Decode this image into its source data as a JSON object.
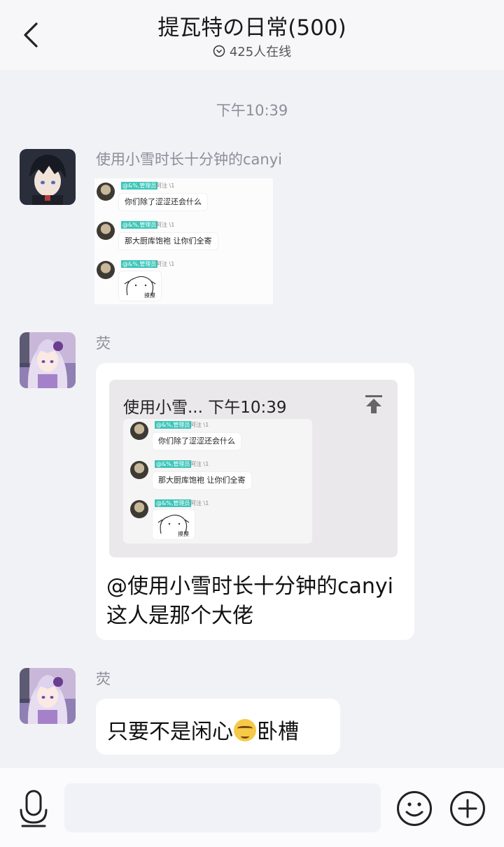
{
  "header": {
    "title": "提瓦特の日常(500)",
    "online_text": "425人在线"
  },
  "timestamp": "下午10:39",
  "messages": [
    {
      "sender": "使用小雪时长十分钟的canyi",
      "screenshot": {
        "rows": [
          {
            "tag": "@&%,管理员",
            "name": "阿注 \\1",
            "text": "你们除了涩涩还会什么"
          },
          {
            "tag": "@&%,管理员",
            "name": "阿注 \\1",
            "text": "那大厨库饱袍 让你们全寄"
          },
          {
            "tag": "@&%,管理员",
            "name": "阿注 \\1",
            "sticker_label": "摸摸"
          }
        ]
      }
    },
    {
      "sender": "荧",
      "quote": {
        "header": "使用小雪...  下午10:39",
        "icon": "pin-to-top-icon"
      },
      "text": "@使用小雪时长十分钟的canyi 这人是那个大佬"
    },
    {
      "sender": "荧",
      "text_before": "只要不是闲心",
      "emoji": "smirk-emoji",
      "text_after": "卧槽"
    }
  ],
  "input_bar": {
    "icons": [
      "microphone-icon",
      "emoji-icon",
      "plus-icon"
    ]
  },
  "colors": {
    "background": "#f1f2f6",
    "bubble": "#ffffff",
    "tag": "#3cc6b8",
    "muted": "#8b8f99"
  }
}
